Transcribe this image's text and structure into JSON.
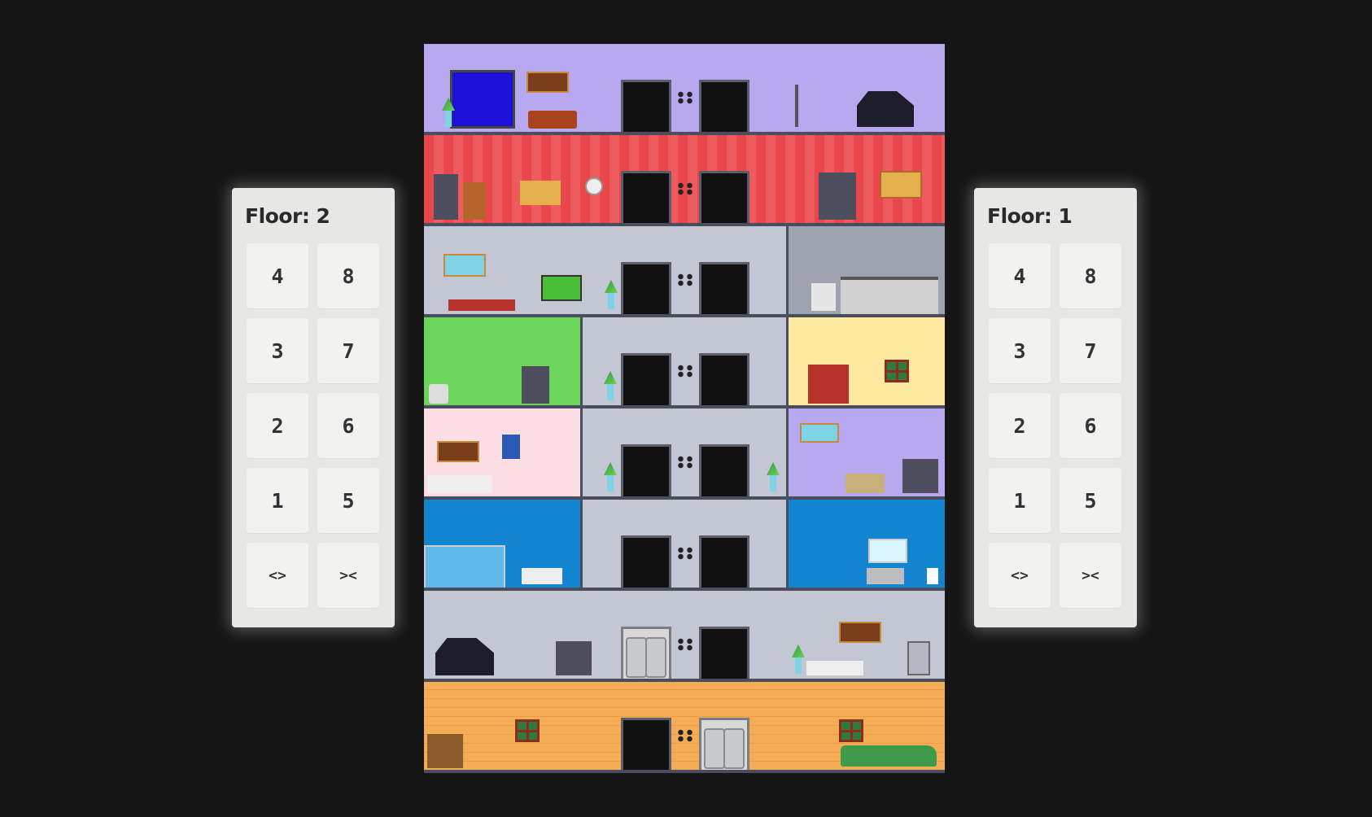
{
  "left_panel": {
    "floor_label": "Floor: 2",
    "buttons": [
      "4",
      "8",
      "3",
      "7",
      "2",
      "6",
      "1",
      "5",
      "<>",
      "><"
    ]
  },
  "right_panel": {
    "floor_label": "Floor: 1",
    "buttons": [
      "4",
      "8",
      "3",
      "7",
      "2",
      "6",
      "1",
      "5",
      "<>",
      "><"
    ]
  },
  "colors": {
    "background": "#151515",
    "panel": "#e7e7e6",
    "button": "#f2f2f1",
    "floor_8_wall": "#b7a8ef",
    "floor_7_wall": "#e9474b",
    "floor_6_wall": "#c3c6d3",
    "floor_5_left_wall": "#6cd65c",
    "floor_5_right_wall": "#ffe9a0",
    "floor_4_left_wall": "#fbdde3",
    "floor_4_right_wall": "#b7a8ef",
    "floor_3_wall": "#1384cf",
    "floor_2_wall": "#c3c6d3",
    "floor_1_wall": "#f4ac55"
  },
  "icons": [
    "elevator-door-icon",
    "elevator-call-dots-icon",
    "piano-icon",
    "plant-icon",
    "window-icon",
    "car-icon"
  ]
}
